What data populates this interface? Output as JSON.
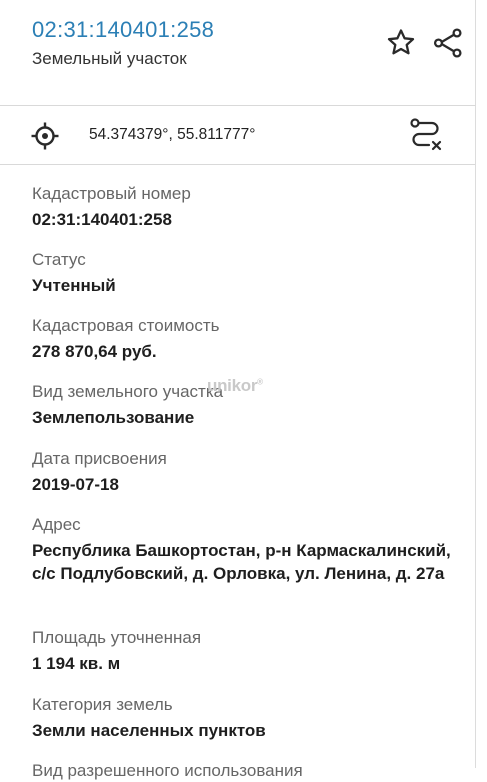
{
  "header": {
    "title": "02:31:140401:258",
    "subtitle": "Земельный участок",
    "icons": [
      "star-icon",
      "share-icon"
    ]
  },
  "coords": {
    "text": "54.374379°, 55.811777°",
    "icons": [
      "target-icon",
      "route-icon"
    ]
  },
  "fields": [
    {
      "label": "Кадастровый номер",
      "value": "02:31:140401:258"
    },
    {
      "label": "Статус",
      "value": "Учтенный"
    },
    {
      "label": "Кадастровая стоимость",
      "value": "278 870,64 руб."
    },
    {
      "label": "Вид земельного участка",
      "value": "Землепользование"
    },
    {
      "label": "Дата присвоения",
      "value": "2019-07-18"
    },
    {
      "label": "Адрес",
      "value": "Республика Башкортостан, р-н Кармаскалинский, с/с Подлубовский, д. Орловка, ул. Ленина, д. 27а"
    },
    {
      "label": "Площадь уточненная",
      "value": "1 194 кв. м"
    },
    {
      "label": "Категория земель",
      "value": "Земли населенных пунктов"
    },
    {
      "label": "Вид разрешенного использования",
      "value": ""
    }
  ],
  "watermark": {
    "text": "unikor",
    "mark": "®"
  },
  "colors": {
    "accent": "#2b7fb5",
    "label": "#666666",
    "value": "#1e1e1e"
  }
}
